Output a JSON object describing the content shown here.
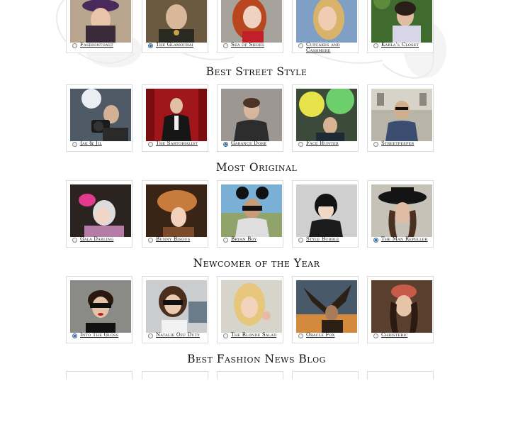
{
  "sections": [
    {
      "title": "",
      "nominees": [
        {
          "label": "Fashiontoast",
          "selected": false
        },
        {
          "label": "The Glamourai",
          "selected": true
        },
        {
          "label": "Sea of Shoes",
          "selected": false
        },
        {
          "label": "Cupcakes and Cashmere",
          "selected": false
        },
        {
          "label": "Karla's Closet",
          "selected": false
        }
      ]
    },
    {
      "title": "Best Street Style",
      "nominees": [
        {
          "label": "Jak & Jil",
          "selected": false
        },
        {
          "label": "The Sartorialist",
          "selected": false
        },
        {
          "label": "Garance Doré",
          "selected": true
        },
        {
          "label": "Face Hunter",
          "selected": false
        },
        {
          "label": "Streetpeeper",
          "selected": false
        }
      ]
    },
    {
      "title": "Most Original",
      "nominees": [
        {
          "label": "Gala Darling",
          "selected": false
        },
        {
          "label": "Bunny Bisous",
          "selected": false
        },
        {
          "label": "Bryan Boy",
          "selected": false
        },
        {
          "label": "Style Bubble",
          "selected": false
        },
        {
          "label": "The Man Repeller",
          "selected": true
        }
      ]
    },
    {
      "title": "Newcomer of the Year",
      "nominees": [
        {
          "label": "Into The Gloss",
          "selected": true
        },
        {
          "label": "Natalie Off Duty",
          "selected": false
        },
        {
          "label": "The Blonde Salad",
          "selected": false
        },
        {
          "label": "Oracle Fox",
          "selected": false
        },
        {
          "label": "Christeric",
          "selected": false
        }
      ]
    },
    {
      "title": "Best Fashion News Blog",
      "nominees": []
    }
  ]
}
